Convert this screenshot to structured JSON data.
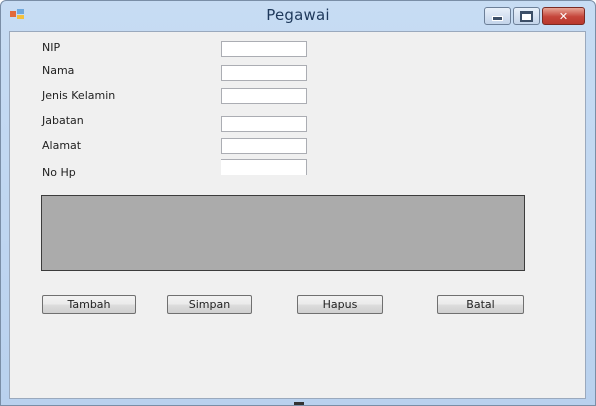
{
  "window": {
    "title": "Pegawai"
  },
  "form": {
    "fields": [
      {
        "label": "NIP",
        "value": ""
      },
      {
        "label": "Nama",
        "value": ""
      },
      {
        "label": "Jenis Kelamin",
        "value": ""
      },
      {
        "label": "Jabatan",
        "value": ""
      },
      {
        "label": "Alamat",
        "value": ""
      },
      {
        "label": "No Hp",
        "value": ""
      }
    ]
  },
  "buttons": {
    "tambah": "Tambah",
    "simpan": "Simpan",
    "hapus": "Hapus",
    "batal": "Batal"
  },
  "colors": {
    "titlebar": "#c7dcf3",
    "client": "#f0f0f0",
    "grid": "#ababab",
    "close": "#c5453a"
  },
  "icons": {
    "app": "form-icon",
    "minimize": "minimize-icon",
    "maximize": "maximize-icon",
    "close": "close-icon"
  }
}
